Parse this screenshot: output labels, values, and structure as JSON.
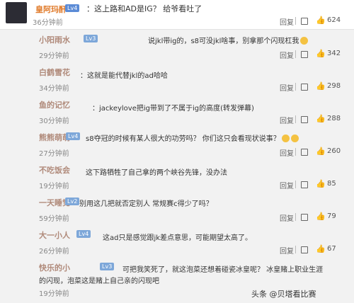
{
  "top": {
    "username": "皇阿玛酐",
    "badge": "Lv4",
    "text": "：这上路和AD是IG？ 给爷看吐了",
    "time": "36分钟前",
    "likes": "624",
    "reply": "回复"
  },
  "comments": [
    {
      "username": "小阳雨水",
      "badge": "Lv3",
      "text": "说jkl带ig的，s8可没jkl啥事，别拿那个闪现杠我",
      "text2": "",
      "time": "29分钟前",
      "likes": "342",
      "reply": "回复"
    },
    {
      "username": "白鹤雪花",
      "badge": "Lv2",
      "text": "：这就是能代替jkl的ad哈哈",
      "text2": "",
      "time": "34分钟前",
      "likes": "298",
      "reply": "回复"
    },
    {
      "username": "鱼的记忆",
      "badge": "Lv1",
      "text": "：jackeylove把ig带到了不属于ig的高度(转发弹幕)",
      "text2": "",
      "time": "30分钟前",
      "likes": "288",
      "reply": "回复"
    },
    {
      "username": "熊熊萌萌",
      "badge": "Lv4",
      "text": "s8夺冠的时候有某人很大的功劳吗？ 你们这只会看现状说事？",
      "text2": "",
      "time": "27分钟前",
      "likes": "260",
      "reply": "回复"
    },
    {
      "username": "不吃饭会",
      "badge": "Lv3",
      "text": "这下路牺牲了自己拿的两个峡谷先锋，没办法",
      "text2": "",
      "time": "19分钟前",
      "likes": "85",
      "reply": "回复"
    },
    {
      "username": "一天睡觉",
      "badge": "Lv2",
      "text": "别用这几把就否定别人 常规赛c得少了吗？",
      "text2": "",
      "time": "59分钟前",
      "likes": "79",
      "reply": "回复"
    },
    {
      "username": "大一小人",
      "badge": "Lv4",
      "text": "这ad只是感觉跟jk差点意思，可能期望太高了。",
      "text2": "",
      "time": "26分钟前",
      "likes": "67",
      "reply": "回复"
    },
    {
      "username": "快乐的小",
      "badge": "Lv3",
      "text": "可把我笑死了，就这泡菜还想着碰瓷冰皇呢？ 冰皇赌上职业生涯",
      "text2": "的闪现，泡菜这是赌上自己亲的闪现吧",
      "time": "19分钟前",
      "likes": "",
      "reply": ""
    }
  ],
  "watermark": "头条 @贝塔看比赛"
}
